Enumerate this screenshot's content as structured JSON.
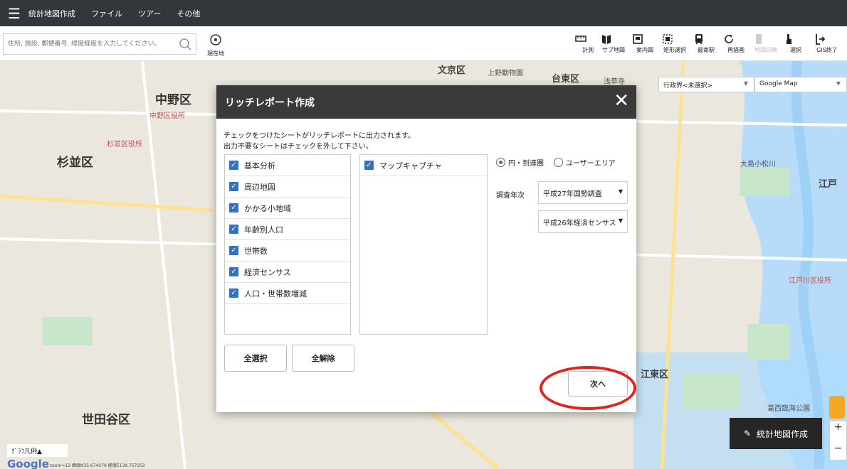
{
  "menubar": {
    "items": [
      "統計地図作成",
      "ファイル",
      "ツアー",
      "その他"
    ]
  },
  "search": {
    "placeholder": "住所, 施設, 郵便番号, 緯度経度を入力してください。"
  },
  "current_location_label": "現在地",
  "tools": [
    {
      "label": "計測",
      "icon": "ruler-icon"
    },
    {
      "label": "サブ地図",
      "icon": "sub-map-icon"
    },
    {
      "label": "案内図",
      "icon": "guide-map-icon"
    },
    {
      "label": "矩形選択",
      "icon": "rect-select-icon"
    },
    {
      "label": "最寄駅",
      "icon": "train-icon"
    },
    {
      "label": "再描画",
      "icon": "refresh-icon"
    },
    {
      "label": "地図印刷",
      "icon": "print-icon",
      "disabled": true
    },
    {
      "label": "選択",
      "icon": "pointer-icon"
    },
    {
      "label": "GIS終了",
      "icon": "exit-icon"
    }
  ],
  "map": {
    "admin_select": "行政界<未選択>",
    "map_type": "Google Map",
    "labels": {
      "nakano": "中野区",
      "suginami": "杉並区",
      "setagaya": "世田谷区",
      "bunkyo": "文京区",
      "taito": "台東区",
      "edogawa": "江戸",
      "koto": "江東区",
      "nakano_office": "中野区役所",
      "suginami_office": "杉並区役所",
      "edogawa_office": "江戸川区役所",
      "ueno_zoo": "上野動物園",
      "asakusa": "浅草寺",
      "oojima": "大島小松川",
      "kasai": "葛西臨海公園"
    },
    "stats_map_button": "統計地図作成",
    "legend": "ｸﾞﾗﾌ凡例▲",
    "google": "Google",
    "coords": "zoom=13 緯度N35.674279 経度E139.757252"
  },
  "dialog": {
    "title": "リッチレポート作成",
    "instructions": [
      "チェックをつけたシートがリッチレポートに出力されます。",
      "出力不要なシートはチェックを外して下さい。"
    ],
    "sheets": [
      "基本分析",
      "周辺地図",
      "かかる小地域",
      "年齢別人口",
      "世帯数",
      "経済センサス",
      "人口・世帯数増減"
    ],
    "sheets_right": [
      "マップキャプチャ"
    ],
    "radio_circle": "円・到達圏",
    "radio_user": "ユーザーエリア",
    "survey_label": "調査年次",
    "survey_census": "平成27年国勢調査",
    "survey_economic": "平成26年経済センサス",
    "select_all": "全選択",
    "deselect_all": "全解除",
    "next": "次へ"
  }
}
